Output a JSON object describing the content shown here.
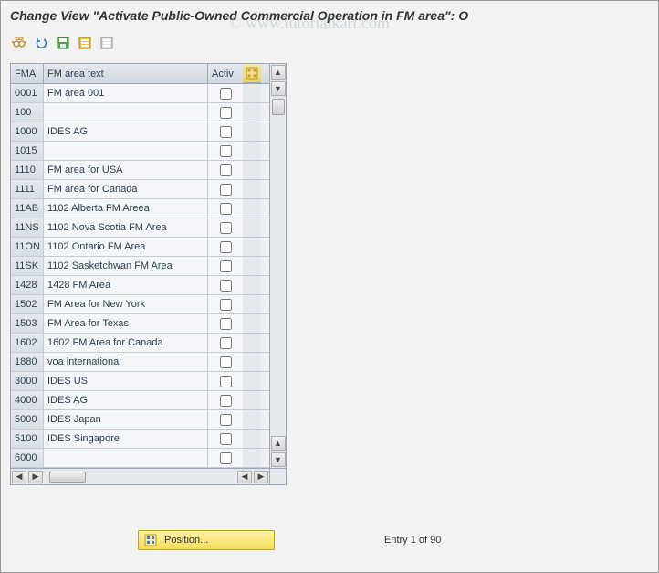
{
  "title": "Change View \"Activate Public-Owned Commercial Operation in FM area\": O",
  "watermark": "© www.tutorialkart.com",
  "toolbar": {
    "other_view": "Other view",
    "undo": "Undo change",
    "save": "Save",
    "select_all": "Select All",
    "deselect_all": "Deselect All"
  },
  "columns": {
    "fma": "FMA",
    "text": "FM area text",
    "activ": "Activ"
  },
  "rows": [
    {
      "fma": "0001",
      "text": "FM area 001",
      "active": false
    },
    {
      "fma": "100",
      "text": "",
      "active": false
    },
    {
      "fma": "1000",
      "text": "IDES AG",
      "active": false
    },
    {
      "fma": "1015",
      "text": "",
      "active": false
    },
    {
      "fma": "1110",
      "text": "FM area for USA",
      "active": false
    },
    {
      "fma": "1111",
      "text": "FM area for Canada",
      "active": false
    },
    {
      "fma": "11AB",
      "text": "1102 Alberta FM Areea",
      "active": false
    },
    {
      "fma": "11NS",
      "text": "1102 Nova Scotia FM Area",
      "active": false
    },
    {
      "fma": "11ON",
      "text": "1102 Ontario FM Area",
      "active": false
    },
    {
      "fma": "11SK",
      "text": "1102 Sasketchwan FM Area",
      "active": false
    },
    {
      "fma": "1428",
      "text": "1428 FM Area",
      "active": false
    },
    {
      "fma": "1502",
      "text": "FM Area for New York",
      "active": false
    },
    {
      "fma": "1503",
      "text": "FM Area for Texas",
      "active": false
    },
    {
      "fma": "1602",
      "text": "1602 FM Area for Canada",
      "active": false
    },
    {
      "fma": "1880",
      "text": "voa international",
      "active": false
    },
    {
      "fma": "3000",
      "text": "IDES US",
      "active": false
    },
    {
      "fma": "4000",
      "text": "IDES AG",
      "active": false
    },
    {
      "fma": "5000",
      "text": "IDES Japan",
      "active": false
    },
    {
      "fma": "5100",
      "text": "IDES Singapore",
      "active": false
    },
    {
      "fma": "6000",
      "text": "",
      "active": false
    }
  ],
  "footer": {
    "position_label": "Position...",
    "entry_text": "Entry 1 of 90"
  }
}
